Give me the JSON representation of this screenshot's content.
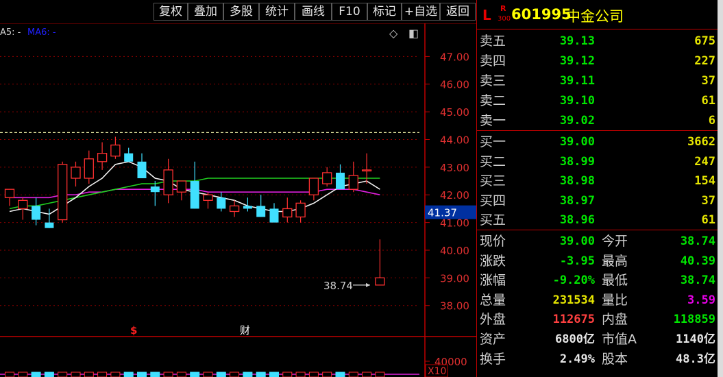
{
  "toolbar": {
    "buttons": [
      "复权",
      "叠加",
      "多股",
      "统计",
      "画线",
      "F10",
      "标记",
      "+自选",
      "返回"
    ]
  },
  "indicator_legend": {
    "ma5": "A5: -",
    "ma6": "MA6: -"
  },
  "chart_icons": {
    "diamond": "◇",
    "toggle": "◧"
  },
  "chart_data": {
    "type": "candlestick",
    "y_ticks": [
      "47.00",
      "46.00",
      "45.00",
      "44.00",
      "43.00",
      "42.00",
      "41.00",
      "40.00",
      "39.00",
      "38.00"
    ],
    "ylim": [
      37.3,
      48.0
    ],
    "dashed_reference": 44.25,
    "current_price_label": "41.37",
    "current_price": 41.37,
    "last_close_annotation": "38.74",
    "volume_axis_label": "40000",
    "volume_unit": "X10",
    "event_markers": [
      "$",
      "财"
    ],
    "candles": [
      {
        "o": 41.9,
        "h": 42.2,
        "l": 41.6,
        "c": 42.2
      },
      {
        "o": 41.5,
        "h": 41.9,
        "l": 41.1,
        "c": 41.8
      },
      {
        "o": 41.6,
        "h": 41.9,
        "l": 40.9,
        "c": 41.1
      },
      {
        "o": 41.0,
        "h": 41.5,
        "l": 40.8,
        "c": 40.8
      },
      {
        "o": 41.1,
        "h": 43.2,
        "l": 41.0,
        "c": 43.1
      },
      {
        "o": 42.6,
        "h": 43.2,
        "l": 42.3,
        "c": 43.0
      },
      {
        "o": 42.6,
        "h": 43.6,
        "l": 42.4,
        "c": 43.3
      },
      {
        "o": 43.2,
        "h": 43.9,
        "l": 42.9,
        "c": 43.5
      },
      {
        "o": 43.4,
        "h": 44.1,
        "l": 43.3,
        "c": 43.8
      },
      {
        "o": 43.5,
        "h": 43.7,
        "l": 43.2,
        "c": 43.2
      },
      {
        "o": 43.2,
        "h": 43.5,
        "l": 42.6,
        "c": 42.6
      },
      {
        "o": 42.3,
        "h": 42.5,
        "l": 41.6,
        "c": 42.1
      },
      {
        "o": 42.0,
        "h": 43.3,
        "l": 41.7,
        "c": 42.9
      },
      {
        "o": 42.1,
        "h": 42.5,
        "l": 41.8,
        "c": 42.5
      },
      {
        "o": 42.5,
        "h": 43.2,
        "l": 41.5,
        "c": 41.5
      },
      {
        "o": 41.8,
        "h": 42.1,
        "l": 41.5,
        "c": 42.0
      },
      {
        "o": 41.9,
        "h": 42.1,
        "l": 41.4,
        "c": 41.5
      },
      {
        "o": 41.4,
        "h": 41.8,
        "l": 41.2,
        "c": 41.6
      },
      {
        "o": 41.6,
        "h": 41.9,
        "l": 41.4,
        "c": 41.5
      },
      {
        "o": 41.6,
        "h": 42.0,
        "l": 41.2,
        "c": 41.2
      },
      {
        "o": 41.5,
        "h": 41.7,
        "l": 41.0,
        "c": 41.0
      },
      {
        "o": 41.2,
        "h": 41.9,
        "l": 41.0,
        "c": 41.5
      },
      {
        "o": 41.2,
        "h": 41.8,
        "l": 41.0,
        "c": 41.7
      },
      {
        "o": 42.0,
        "h": 42.5,
        "l": 41.8,
        "c": 42.6
      },
      {
        "o": 42.4,
        "h": 43.0,
        "l": 42.3,
        "c": 42.8
      },
      {
        "o": 42.8,
        "h": 43.1,
        "l": 42.2,
        "c": 42.2
      },
      {
        "o": 42.2,
        "h": 43.2,
        "l": 42.1,
        "c": 42.7
      },
      {
        "o": 42.9,
        "h": 43.5,
        "l": 42.4,
        "c": 42.9
      },
      {
        "o": 38.74,
        "h": 40.39,
        "l": 38.74,
        "c": 39.0
      }
    ],
    "ma_white": [
      41.4,
      41.5,
      41.4,
      41.3,
      41.6,
      41.9,
      42.3,
      42.6,
      43.1,
      43.2,
      43.0,
      42.6,
      42.5,
      42.2,
      42.1,
      42.0,
      41.9,
      41.8,
      41.6,
      41.5,
      41.4,
      41.4,
      41.5,
      41.7,
      42.0,
      42.3,
      42.4,
      42.5,
      42.2
    ],
    "ma_green": [
      41.5,
      41.6,
      41.6,
      41.7,
      41.8,
      41.9,
      42.0,
      42.1,
      42.2,
      42.3,
      42.4,
      42.4,
      42.5,
      42.5,
      42.5,
      42.6,
      42.6,
      42.6,
      42.6,
      42.6,
      42.6,
      42.6,
      42.6,
      42.6,
      42.6,
      42.6,
      42.6,
      42.6,
      42.6
    ],
    "ma_magenta": [
      41.9,
      41.9,
      41.9,
      41.9,
      42.0,
      42.0,
      42.1,
      42.1,
      42.2,
      42.2,
      42.2,
      42.2,
      42.2,
      42.2,
      42.2,
      42.1,
      42.1,
      42.1,
      42.1,
      42.1,
      42.1,
      42.1,
      42.1,
      42.1,
      42.2,
      42.2,
      42.2,
      42.1,
      42.0
    ]
  },
  "quote": {
    "header": {
      "l": "L",
      "r": "R",
      "sub": "300",
      "code": "601995",
      "name": "中金公司"
    },
    "asks": [
      {
        "label": "卖五",
        "price": "39.13",
        "vol": "675"
      },
      {
        "label": "卖四",
        "price": "39.12",
        "vol": "227"
      },
      {
        "label": "卖三",
        "price": "39.11",
        "vol": "37"
      },
      {
        "label": "卖二",
        "price": "39.10",
        "vol": "61"
      },
      {
        "label": "卖一",
        "price": "39.02",
        "vol": "6"
      }
    ],
    "bids": [
      {
        "label": "买一",
        "price": "39.00",
        "vol": "3662"
      },
      {
        "label": "买二",
        "price": "38.99",
        "vol": "247"
      },
      {
        "label": "买三",
        "price": "38.98",
        "vol": "154"
      },
      {
        "label": "买四",
        "price": "38.97",
        "vol": "37"
      },
      {
        "label": "买五",
        "price": "38.96",
        "vol": "61"
      }
    ],
    "stats": [
      {
        "l1": "现价",
        "v1": "39.00",
        "c1": "#00e600",
        "l2": "今开",
        "v2": "38.74",
        "c2": "#00e600"
      },
      {
        "l1": "涨跌",
        "v1": "-3.95",
        "c1": "#00e600",
        "l2": "最高",
        "v2": "40.39",
        "c2": "#00e600"
      },
      {
        "l1": "涨幅",
        "v1": "-9.20%",
        "c1": "#00e600",
        "l2": "最低",
        "v2": "38.74",
        "c2": "#00e600"
      },
      {
        "l1": "总量",
        "v1": "231534",
        "c1": "#e6e600",
        "l2": "量比",
        "v2": "3.59",
        "c2": "#e600e6"
      },
      {
        "l1": "外盘",
        "v1": "112675",
        "c1": "#ff4040",
        "l2": "内盘",
        "v2": "118859",
        "c2": "#00e600"
      },
      {
        "l1": "资产",
        "v1": "6800亿",
        "c1": "#e6e6e6",
        "l2": "市值A",
        "v2": "1140亿",
        "c2": "#e6e6e6"
      },
      {
        "l1": "换手",
        "v1": "2.49%",
        "c1": "#e6e6e6",
        "l2": "股本",
        "v2": "48.3亿",
        "c2": "#e6e6e6"
      }
    ]
  }
}
